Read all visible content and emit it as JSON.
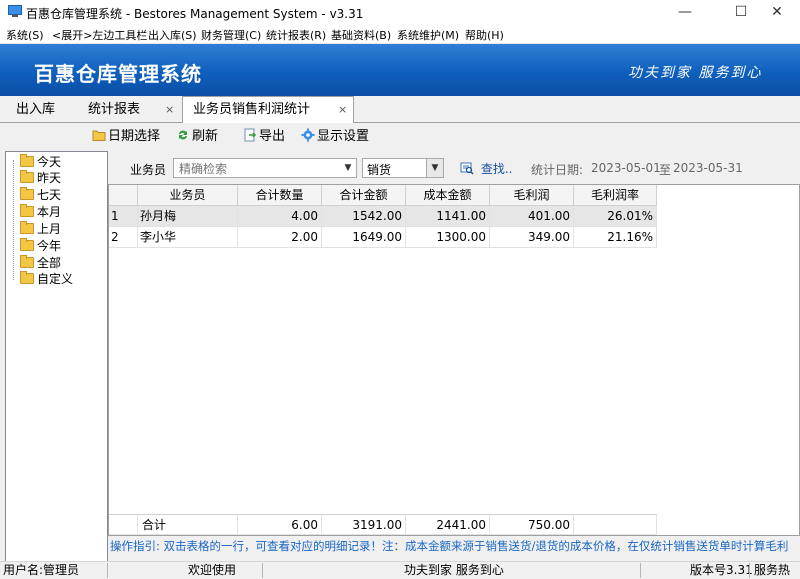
{
  "window": {
    "title": "百惠仓库管理系统 - Bestores Management System - v3.31",
    "minimize": "—",
    "maximize": "☐",
    "close": "✕"
  },
  "menu": [
    "系统(S)",
    "<展开>左边工具栏",
    "出入库(S)",
    "财务管理(C)",
    "统计报表(R)",
    "基础资料(B)",
    "系统维护(M)",
    "帮助(H)"
  ],
  "banner": {
    "title": "百惠仓库管理系统",
    "slogan": "功夫到家 服务到心"
  },
  "tabs": [
    {
      "label": "出入库",
      "closable": false,
      "active": false
    },
    {
      "label": "统计报表",
      "closable": true,
      "active": false
    },
    {
      "label": "业务员销售利润统计",
      "closable": true,
      "active": true
    }
  ],
  "tab_close_glyph": "×",
  "toolbar": {
    "date_select": "日期选择",
    "refresh": "刷新",
    "export": "导出",
    "display_settings": "显示设置"
  },
  "tree": [
    "今天",
    "昨天",
    "七天",
    "本月",
    "上月",
    "今年",
    "全部",
    "自定义"
  ],
  "filter": {
    "salesperson_label": "业务员",
    "search_placeholder": "精确检索",
    "type_value": "销货",
    "find_label": "查找..",
    "stat_date_label": "统计日期:",
    "date_from": "2023-05-01",
    "date_to_word": "至",
    "date_to": "2023-05-31"
  },
  "table": {
    "columns": [
      "业务员",
      "合计数量",
      "合计金额",
      "成本金额",
      "毛利润",
      "毛利润率"
    ],
    "rows": [
      {
        "idx": "1",
        "name": "孙月梅",
        "qty": "4.00",
        "amount": "1542.00",
        "cost": "1141.00",
        "profit": "401.00",
        "rate": "26.01%"
      },
      {
        "idx": "2",
        "name": "李小华",
        "qty": "2.00",
        "amount": "1649.00",
        "cost": "1300.00",
        "profit": "349.00",
        "rate": "21.16%"
      }
    ],
    "summary": {
      "label": "合计",
      "qty": "6.00",
      "amount": "3191.00",
      "cost": "2441.00",
      "profit": "750.00"
    }
  },
  "hint": "操作指引: 双击表格的一行，可查看对应的明细记录！注：成本金额来源于销售送货/退货的成本价格，在仅统计销售送货单时计算毛利",
  "status": {
    "user": "用户名:管理员",
    "welcome": "欢迎使用",
    "slogan": "功夫到家 服务到心",
    "version": "版本号3.31",
    "service": "服务热"
  },
  "colors": {
    "banner": "#0f5fbd",
    "hint": "#1a66c2",
    "row_selected": "#e6e6e6"
  }
}
